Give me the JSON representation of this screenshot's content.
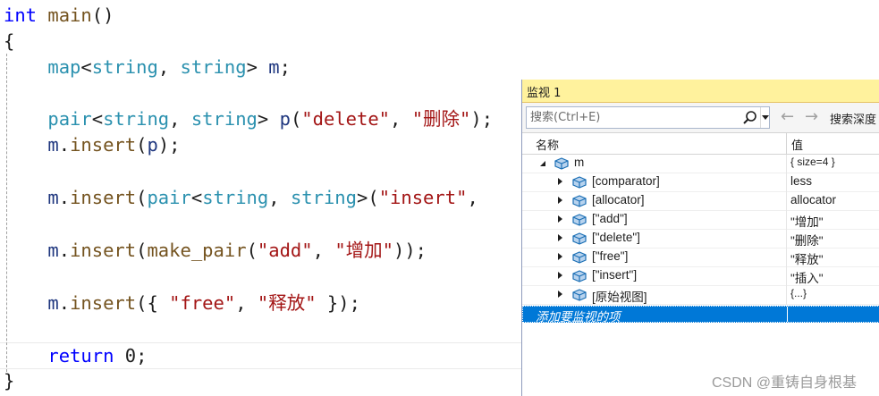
{
  "editor": {
    "lines": [
      [
        {
          "t": "int",
          "c": "kw"
        },
        {
          "t": " ",
          "c": "txt"
        },
        {
          "t": "main",
          "c": "fn"
        },
        {
          "t": "()",
          "c": "pun"
        }
      ],
      [
        {
          "t": "{",
          "c": "pun"
        }
      ],
      [
        {
          "t": "    ",
          "c": "txt"
        },
        {
          "t": "map",
          "c": "ty"
        },
        {
          "t": "<",
          "c": "pun"
        },
        {
          "t": "string",
          "c": "ty"
        },
        {
          "t": ", ",
          "c": "pun"
        },
        {
          "t": "string",
          "c": "ty"
        },
        {
          "t": "> ",
          "c": "pun"
        },
        {
          "t": "m",
          "c": "vr"
        },
        {
          "t": ";",
          "c": "pun"
        }
      ],
      [
        {
          "t": "    ",
          "c": "txt"
        },
        {
          "t": "pair",
          "c": "ty"
        },
        {
          "t": "<",
          "c": "pun"
        },
        {
          "t": "string",
          "c": "ty"
        },
        {
          "t": ", ",
          "c": "pun"
        },
        {
          "t": "string",
          "c": "ty"
        },
        {
          "t": "> ",
          "c": "pun"
        },
        {
          "t": "p",
          "c": "vr"
        },
        {
          "t": "(",
          "c": "pun"
        },
        {
          "t": "\"delete\"",
          "c": "str"
        },
        {
          "t": ", ",
          "c": "pun"
        },
        {
          "t": "\"删除\"",
          "c": "str"
        },
        {
          "t": ");",
          "c": "pun"
        }
      ],
      [
        {
          "t": "    ",
          "c": "txt"
        },
        {
          "t": "m",
          "c": "vr"
        },
        {
          "t": ".",
          "c": "pun"
        },
        {
          "t": "insert",
          "c": "fn"
        },
        {
          "t": "(",
          "c": "pun"
        },
        {
          "t": "p",
          "c": "vr"
        },
        {
          "t": ");",
          "c": "pun"
        }
      ],
      [
        {
          "t": "    ",
          "c": "txt"
        },
        {
          "t": "m",
          "c": "vr"
        },
        {
          "t": ".",
          "c": "pun"
        },
        {
          "t": "insert",
          "c": "fn"
        },
        {
          "t": "(",
          "c": "pun"
        },
        {
          "t": "pair",
          "c": "ty"
        },
        {
          "t": "<",
          "c": "pun"
        },
        {
          "t": "string",
          "c": "ty"
        },
        {
          "t": ", ",
          "c": "pun"
        },
        {
          "t": "string",
          "c": "ty"
        },
        {
          "t": ">(",
          "c": "pun"
        },
        {
          "t": "\"insert\"",
          "c": "str"
        },
        {
          "t": ",",
          "c": "pun"
        }
      ],
      [
        {
          "t": "    ",
          "c": "txt"
        },
        {
          "t": "m",
          "c": "vr"
        },
        {
          "t": ".",
          "c": "pun"
        },
        {
          "t": "insert",
          "c": "fn"
        },
        {
          "t": "(",
          "c": "pun"
        },
        {
          "t": "make_pair",
          "c": "fn"
        },
        {
          "t": "(",
          "c": "pun"
        },
        {
          "t": "\"add\"",
          "c": "str"
        },
        {
          "t": ", ",
          "c": "pun"
        },
        {
          "t": "\"增加\"",
          "c": "str"
        },
        {
          "t": "));",
          "c": "pun"
        }
      ],
      [
        {
          "t": "    ",
          "c": "txt"
        },
        {
          "t": "m",
          "c": "vr"
        },
        {
          "t": ".",
          "c": "pun"
        },
        {
          "t": "insert",
          "c": "fn"
        },
        {
          "t": "({ ",
          "c": "pun"
        },
        {
          "t": "\"free\"",
          "c": "str"
        },
        {
          "t": ", ",
          "c": "pun"
        },
        {
          "t": "\"释放\"",
          "c": "str"
        },
        {
          "t": " });",
          "c": "pun"
        }
      ],
      [
        {
          "t": "    ",
          "c": "txt"
        },
        {
          "t": "return",
          "c": "kw"
        },
        {
          "t": " ",
          "c": "txt"
        },
        {
          "t": "0",
          "c": "num"
        },
        {
          "t": ";",
          "c": "pun"
        }
      ],
      [
        {
          "t": "}",
          "c": "pun"
        }
      ]
    ]
  },
  "watch": {
    "title": "监视 1",
    "search_placeholder": "搜索(Ctrl+E)",
    "depth_label": "搜索深度",
    "col_name": "名称",
    "col_value": "值",
    "rows": [
      {
        "name": "m",
        "value": "{ size=4 }",
        "level": 0,
        "expanded": true
      },
      {
        "name": "[comparator]",
        "value": "less",
        "level": 1,
        "expanded": false
      },
      {
        "name": "[allocator]",
        "value": "allocator",
        "level": 1,
        "expanded": false
      },
      {
        "name": "[\"add\"]",
        "value": "\"增加\"",
        "level": 1,
        "expanded": false
      },
      {
        "name": "[\"delete\"]",
        "value": "\"删除\"",
        "level": 1,
        "expanded": false
      },
      {
        "name": "[\"free\"]",
        "value": "\"释放\"",
        "level": 1,
        "expanded": false
      },
      {
        "name": "[\"insert\"]",
        "value": "\"插入\"",
        "level": 1,
        "expanded": false
      },
      {
        "name": "[原始视图]",
        "value": "{...}",
        "level": 1,
        "expanded": false
      }
    ],
    "add_item_label": "添加要监视的项"
  },
  "watermark": "CSDN @重铸自身根基",
  "colors": {
    "keyword": "#0000ff",
    "type": "#2b91af",
    "string": "#a31515",
    "function": "#74531f",
    "title_bar": "#fff29d",
    "selection": "#0078d7"
  }
}
